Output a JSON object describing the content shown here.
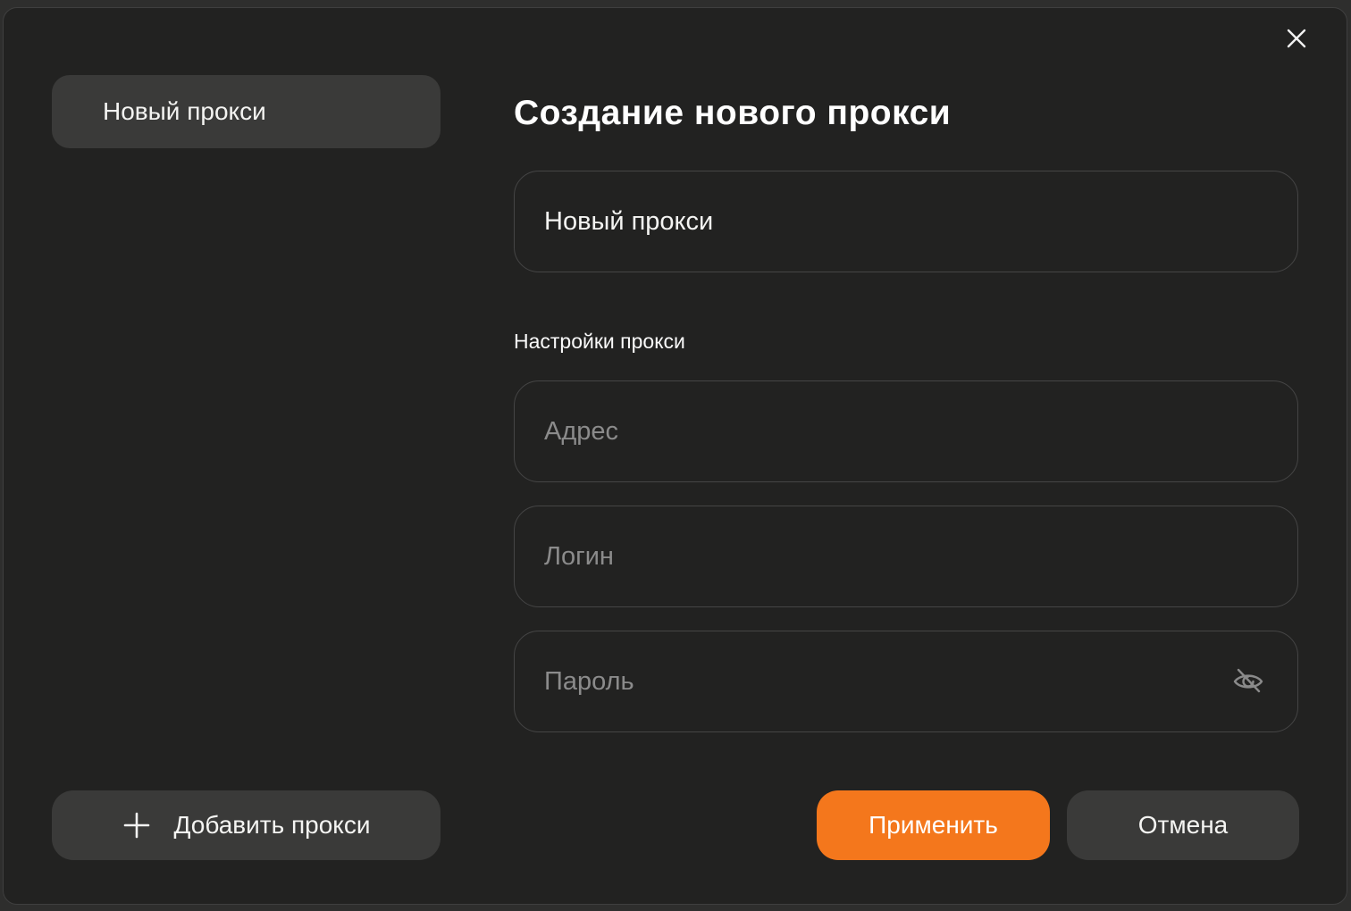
{
  "dialog": {
    "title": "Создание нового прокси",
    "name_input": {
      "value": "Новый прокси"
    },
    "section_label": "Настройки прокси",
    "fields": [
      {
        "placeholder": "Адрес"
      },
      {
        "placeholder": "Логин"
      },
      {
        "placeholder": "Пароль",
        "has_visibility_toggle": true
      }
    ]
  },
  "sidebar": {
    "items": [
      {
        "label": "Новый прокси",
        "selected": true
      }
    ],
    "add_button_label": "Добавить прокси"
  },
  "footer": {
    "apply_label": "Применить",
    "cancel_label": "Отмена"
  },
  "icons": {
    "close": "✕",
    "plus": "+",
    "password_visibility": "eye-off"
  },
  "colors": {
    "accent": "#f4771c",
    "backdrop": "#2e2e2d",
    "modal_background": "#222221",
    "surface": "#3a3a39",
    "input_border": "#454545",
    "placeholder_text": "#8b8b8b"
  }
}
